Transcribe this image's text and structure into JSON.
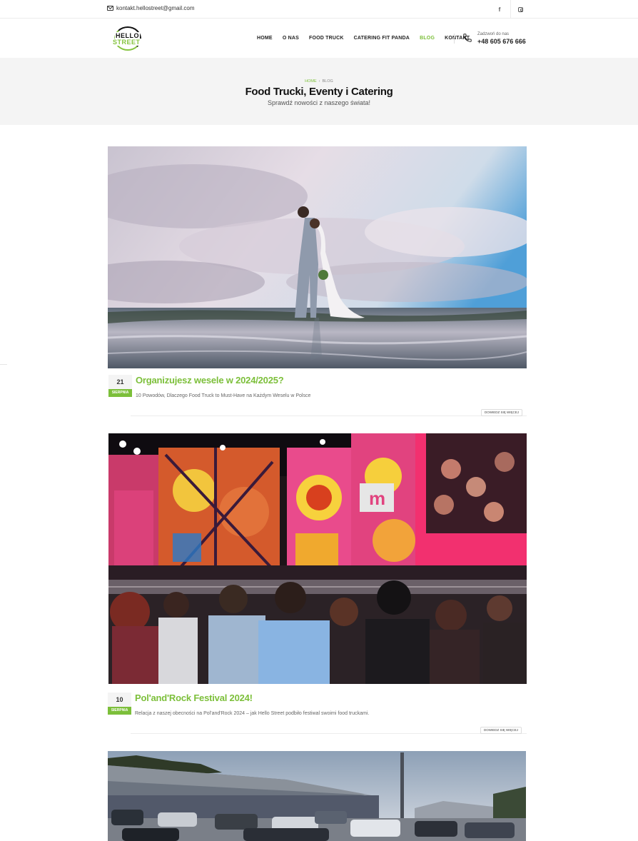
{
  "topbar": {
    "email": "kontakt.hellostreet@gmail.com",
    "social": [
      "facebook-icon",
      "instagram-icon"
    ]
  },
  "header": {
    "logo": {
      "line1": "HELLO",
      "line2": "STREET"
    },
    "nav": [
      {
        "label": "HOME",
        "active": false
      },
      {
        "label": "O NAS",
        "active": false
      },
      {
        "label": "FOOD TRUCK",
        "active": false
      },
      {
        "label": "CATERING FIT PANDA",
        "active": false
      },
      {
        "label": "BLOG",
        "active": true
      },
      {
        "label": "KONTAKT",
        "active": false
      }
    ],
    "phone": {
      "caption": "Zadzwoń do nas",
      "number": "+48 605 676 666"
    }
  },
  "title_band": {
    "breadcrumb": {
      "home": "HOME",
      "separator": "›",
      "current": "BLOG"
    },
    "title": "Food Trucki, Eventy i Catering",
    "subtitle": "Sprawdź nowości z naszego świata!"
  },
  "posts": [
    {
      "day": "21",
      "month": "Sierpnia",
      "title": "Organizujesz wesele w 2024/2025?",
      "excerpt": "10 Powodów, Dlaczego Food Truck to Must-Have na Każdym Weselu w Polsce",
      "more": "Dowiedz się więcej",
      "image": "wedding-couple-photo"
    },
    {
      "day": "10",
      "month": "Sierpnia",
      "title": "Pol'and'Rock Festival 2024!",
      "excerpt": "Relacja z naszej obecności na Pol'and'Rock 2024 – jak Hello Street podbiło festiwal swoimi food truckami.",
      "more": "Dowiedz się więcej",
      "image": "festival-stage-photo"
    },
    {
      "image": "parking-lot-photo"
    }
  ],
  "colors": {
    "accent": "#7cbf3a",
    "band": "#f4f4f4"
  }
}
